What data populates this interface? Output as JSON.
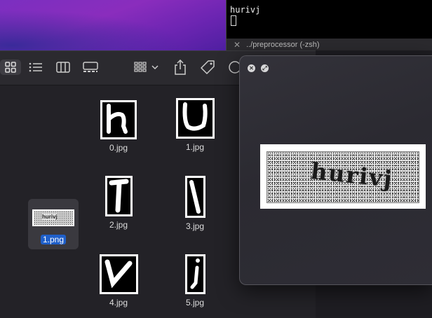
{
  "terminal": {
    "command_output": "hurivj",
    "tab_title": "../preprocessor (-zsh)"
  },
  "finder": {
    "toolbar": {
      "icon_view": "square-grid-icon",
      "list_view": "list-icon",
      "column_view": "columns-icon",
      "gallery_view": "gallery-icon",
      "group": "group-grid-icon",
      "share": "share-icon",
      "tag": "tag-icon",
      "more": "ellipsis-icon"
    },
    "files": [
      {
        "name": "0.jpg"
      },
      {
        "name": "1.jpg"
      },
      {
        "name": "2.jpg"
      },
      {
        "name": "3.jpg"
      },
      {
        "name": "4.jpg"
      },
      {
        "name": "5.jpg"
      }
    ],
    "selected_file": {
      "name": "1.png",
      "thumb_text": "hurivj"
    }
  },
  "preview": {
    "captcha_text": "hurivj"
  },
  "colors": {
    "selection": "#1f5fc9",
    "wallpaper": "#7b2fc0"
  }
}
